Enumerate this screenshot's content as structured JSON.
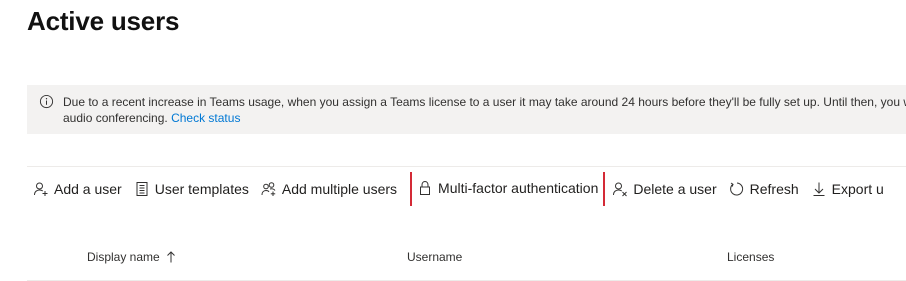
{
  "page": {
    "title": "Active users"
  },
  "banner": {
    "icon": "info-icon",
    "line1": "Due to a recent increase in Teams usage, when you assign a Teams license to a user it may take around 24 hours before they'll be fully set up. Until then, you wo",
    "line2_text": "audio conferencing. ",
    "link_text": "Check status",
    "link_color": "#0078d4"
  },
  "toolbar": {
    "add_user": "Add a user",
    "user_templates": "User templates",
    "add_multiple_users": "Add multiple users",
    "mfa": "Multi-factor authentication",
    "delete_user": "Delete a user",
    "refresh": "Refresh",
    "export": "Export u",
    "highlight_color": "#d42a36"
  },
  "table": {
    "columns": [
      {
        "label": "Display name",
        "sort": "ascending"
      },
      {
        "label": "Username"
      },
      {
        "label": "Licenses"
      }
    ]
  }
}
